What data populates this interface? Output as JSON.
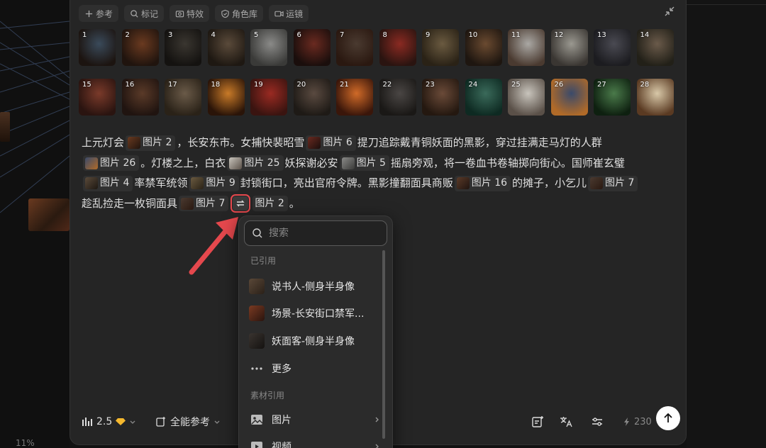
{
  "background": {
    "zoom_label": "11%"
  },
  "toolbar": [
    {
      "id": "ref",
      "label": "参考"
    },
    {
      "id": "mark",
      "label": "标记"
    },
    {
      "id": "effect",
      "label": "特效"
    },
    {
      "id": "role",
      "label": "角色库"
    },
    {
      "id": "camera",
      "label": "运镜"
    }
  ],
  "thumbnails": [
    {
      "n": "1",
      "c1": "#3a4a5a",
      "c2": "#1c1410"
    },
    {
      "n": "2",
      "c1": "#6a3a20",
      "c2": "#20140e"
    },
    {
      "n": "3",
      "c1": "#3a3630",
      "c2": "#141210"
    },
    {
      "n": "4",
      "c1": "#5a4a3a",
      "c2": "#1e1812"
    },
    {
      "n": "5",
      "c1": "#8a8a88",
      "c2": "#3a3a38"
    },
    {
      "n": "6",
      "c1": "#6a2a20",
      "c2": "#1a0e0c"
    },
    {
      "n": "7",
      "c1": "#4a3a30",
      "c2": "#2a1810"
    },
    {
      "n": "8",
      "c1": "#8a2a22",
      "c2": "#2a1410"
    },
    {
      "n": "9",
      "c1": "#6a5a40",
      "c2": "#2a2216"
    },
    {
      "n": "10",
      "c1": "#6a4a30",
      "c2": "#1e1610"
    },
    {
      "n": "11",
      "c1": "#aaa8a4",
      "c2": "#4a3a30"
    },
    {
      "n": "12",
      "c1": "#9a9890",
      "c2": "#3a3632"
    },
    {
      "n": "13",
      "c1": "#4a4a52",
      "c2": "#1c1c20"
    },
    {
      "n": "14",
      "c1": "#6a5a4a",
      "c2": "#222018"
    },
    {
      "n": "15",
      "c1": "#7a3a2a",
      "c2": "#2a1410"
    },
    {
      "n": "16",
      "c1": "#5a3a28",
      "c2": "#201410"
    },
    {
      "n": "17",
      "c1": "#6a5a48",
      "c2": "#2a2218"
    },
    {
      "n": "18",
      "c1": "#c87a28",
      "c2": "#2a1408"
    },
    {
      "n": "19",
      "c1": "#9a2a22",
      "c2": "#3a1410"
    },
    {
      "n": "20",
      "c1": "#5a4a40",
      "c2": "#1e1a16"
    },
    {
      "n": "21",
      "c1": "#d06a28",
      "c2": "#3a160a"
    },
    {
      "n": "22",
      "c1": "#4a4644",
      "c2": "#1a1816"
    },
    {
      "n": "23",
      "c1": "#6a4a38",
      "c2": "#241810"
    },
    {
      "n": "24",
      "c1": "#3a6a5a",
      "c2": "#0e2a22"
    },
    {
      "n": "25",
      "c1": "#c8c4bc",
      "c2": "#5a5048"
    },
    {
      "n": "26",
      "c1": "#3a4a6a",
      "c2": "#b06a28"
    },
    {
      "n": "27",
      "c1": "#4a7a4a",
      "c2": "#0e2010"
    },
    {
      "n": "28",
      "c1": "#d8c8a8",
      "c2": "#5a3a22"
    }
  ],
  "prompt": {
    "t1": "上元灯会",
    "c1": "图片 2",
    "t2": "，长安东市。女捕快裴昭雪",
    "c2": "图片 6",
    "t3": "提刀追踪戴青铜妖面的黑影，穿过挂满走马灯的人群",
    "c3": "图片 26",
    "t4": "。灯楼之上，白衣",
    "c4": "图片 25",
    "t5": "妖探谢必安",
    "c5": "图片 5",
    "t6": "摇扇旁观，将一卷血书卷轴掷向街心。国师崔玄璧",
    "c6": "图片 4",
    "t7": "率禁军统领",
    "c7": "图片 9",
    "t8": "封锁街口，亮出官府令牌。黑影撞翻面具商贩",
    "c8": "图片 16",
    "t9": "的摊子，小乞儿",
    "c9": "图片 7",
    "t10": "趁乱捡走一枚铜面具",
    "c10": "图片 7",
    "c11": "图片 2",
    "t11": "。"
  },
  "dropdown": {
    "search_placeholder": "搜索",
    "section_cited": "已引用",
    "cited": [
      {
        "label": "说书人-侧身半身像",
        "c1": "#5a4838",
        "c2": "#2a2018"
      },
      {
        "label": "场景-长安街口禁军...",
        "c1": "#7a3a22",
        "c2": "#2a140e"
      },
      {
        "label": "妖面客-侧身半身像",
        "c1": "#3a3430",
        "c2": "#141210"
      }
    ],
    "more_label": "更多",
    "section_material": "素材引用",
    "materials": [
      {
        "label": "图片"
      },
      {
        "label": "视频"
      }
    ]
  },
  "bottom": {
    "model_label": "2.5",
    "ref_label": "全能参考",
    "credits": "230"
  },
  "colors": {
    "panel": "#252525",
    "highlight": "#e5484d",
    "arrow": "#e5484d",
    "gem": "#f5b82e"
  }
}
